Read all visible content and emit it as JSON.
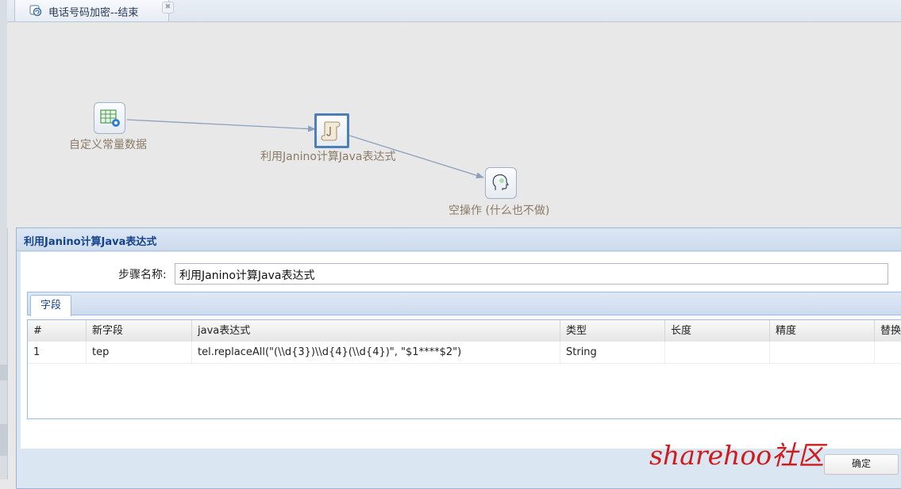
{
  "tab": {
    "title": "电话号码加密--结束",
    "close_label": "✖"
  },
  "canvas": {
    "steps": [
      {
        "label": "自定义常量数据",
        "icon": "table-gear-icon"
      },
      {
        "label": "利用Janino计算Java表达式",
        "icon": "script-icon"
      },
      {
        "label": "空操作 (什么也不做)",
        "icon": "head-icon"
      }
    ]
  },
  "dialog": {
    "title": "利用Janino计算Java表达式",
    "step_name_label": "步骤名称:",
    "step_name_value": "利用Janino计算Java表达式",
    "tab_fields": "字段",
    "columns": [
      "#",
      "新字段",
      "java表达式",
      "类型",
      "长度",
      "精度",
      "替换"
    ],
    "rows": [
      [
        "1",
        "tep",
        "tel.replaceAll(\"(\\\\d{3})\\\\d{4}(\\\\d{4})\", \"$1****$2\")",
        "String",
        "",
        "",
        ""
      ]
    ],
    "ok_label": "确定"
  },
  "watermark": "sharehoo社区",
  "colors": {
    "accent": "#15428b",
    "watermark": "#d21a1a",
    "selected_border": "#4b7fb8"
  }
}
